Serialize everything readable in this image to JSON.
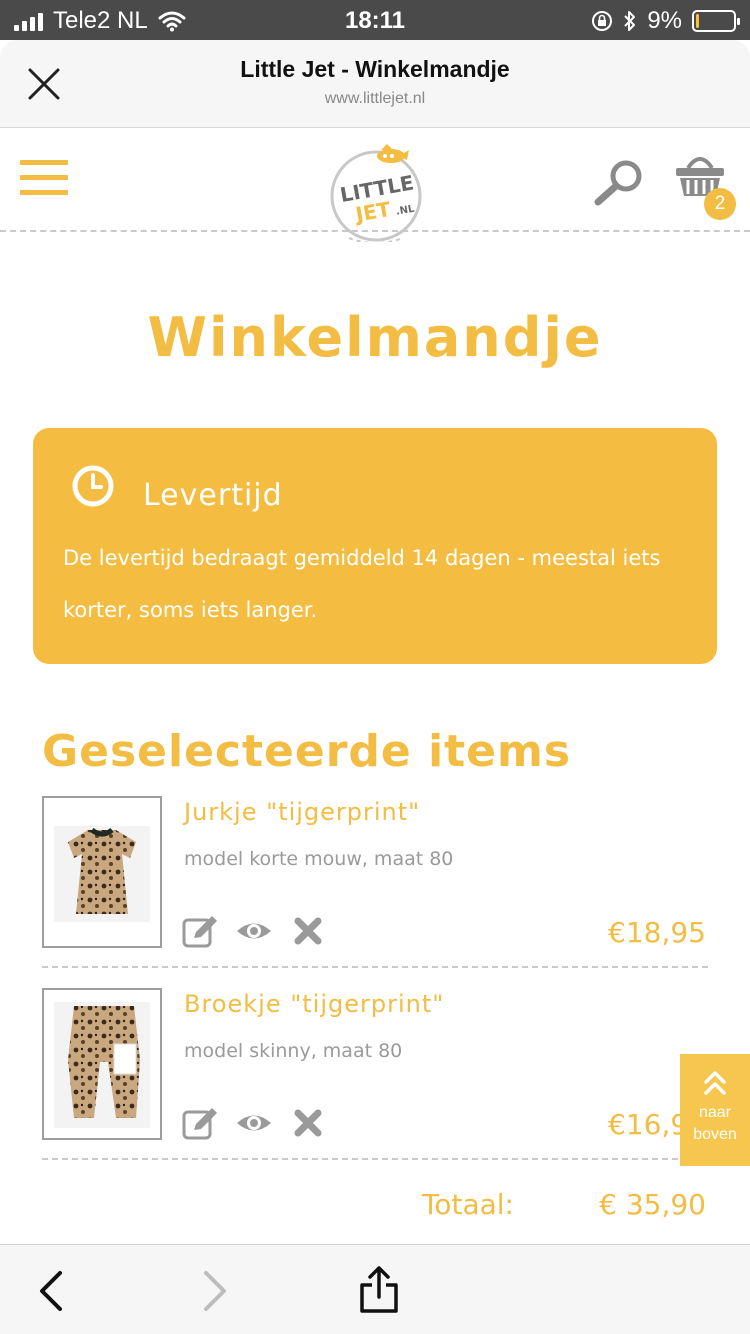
{
  "status_bar": {
    "carrier": "Tele2 NL",
    "time": "18:11",
    "battery_percent": "9%",
    "battery_level": 0.09
  },
  "browser": {
    "title": "Little Jet - Winkelmandje",
    "url": "www.littlejet.nl"
  },
  "header": {
    "cart_count": "2",
    "logo_line1": "LITTLE",
    "logo_line2": "JET",
    "logo_suffix": ".NL"
  },
  "page": {
    "title": "Winkelmandje"
  },
  "delivery": {
    "heading": "Levertijd",
    "text": "De levertijd bedraagt gemiddeld 14 dagen - meestal iets korter, soms iets langer."
  },
  "items_section": {
    "heading": "Geselecteerde items",
    "items": [
      {
        "name": "Jurkje \"tijgerprint\"",
        "description": "model korte mouw, maat 80",
        "price": "€18,95"
      },
      {
        "name": "Broekje \"tijgerprint\"",
        "description": "model skinny, maat 80",
        "price": "€16,95"
      }
    ]
  },
  "total": {
    "label": "Totaal:",
    "value": "€ 35,90"
  },
  "to_top": {
    "line1": "naar",
    "line2": "boven"
  },
  "colors": {
    "accent": "#f2bd42",
    "status_bar": "#4a4a4a",
    "text_muted": "#9a9a9a"
  }
}
